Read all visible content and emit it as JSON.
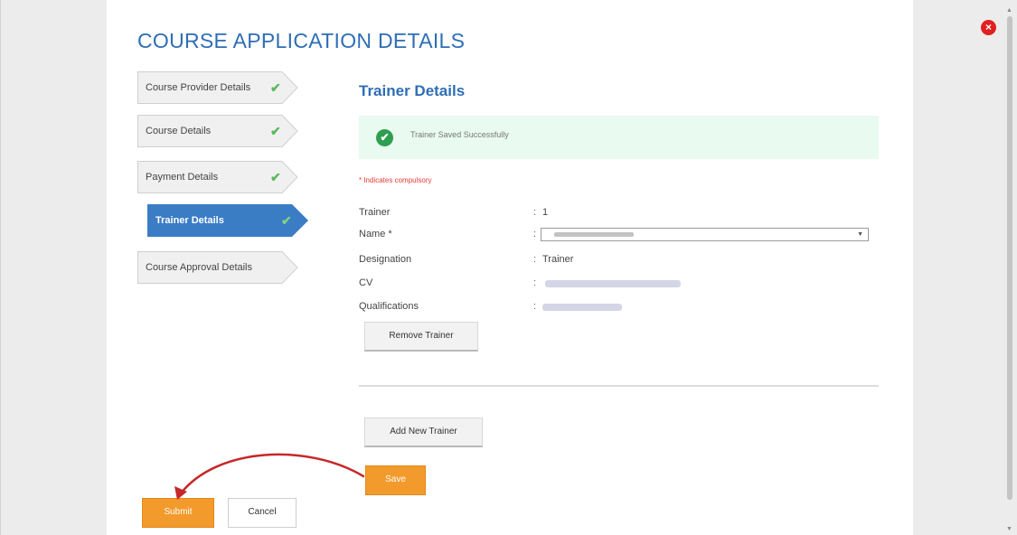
{
  "window": {
    "close_symbol": "×"
  },
  "page_title": "COURSE APPLICATION DETAILS",
  "steps": [
    {
      "label": "Course Provider Details",
      "status": "complete",
      "check": "✔"
    },
    {
      "label": "Course Details",
      "status": "complete",
      "check": "✔"
    },
    {
      "label": "Payment Details",
      "status": "complete",
      "check": "✔"
    },
    {
      "label": "Trainer Details",
      "status": "active",
      "check": "✔"
    },
    {
      "label": "Course Approval Details",
      "status": "pending",
      "check": ""
    }
  ],
  "section_title": "Trainer Details",
  "alert": {
    "icon": "✔",
    "message": "Trainer Saved Successfully"
  },
  "required_note": "* Indicates compulsory",
  "trainer": {
    "colon": ":",
    "trainer_label": "Trainer",
    "trainer_number": "1",
    "name_label": "Name *",
    "name_chevron": "▼",
    "designation_label": "Designation",
    "designation_value": "Trainer",
    "cv_label": "CV",
    "qualifications_label": "Qualifications"
  },
  "buttons": {
    "remove_trainer": "Remove Trainer",
    "add_new_trainer": "Add New Trainer",
    "save": "Save",
    "submit": "Submit",
    "cancel": "Cancel"
  },
  "colors": {
    "accent": "#2f6eb5",
    "success_bg": "#e9faf0",
    "success_icon": "#2e9e4f",
    "warning_button": "#f39a2c",
    "annotation_arrow": "#c62828"
  },
  "icons": [
    "close-icon",
    "check-icon",
    "success-check-icon",
    "chevron-down-icon",
    "annotation-arrow"
  ]
}
